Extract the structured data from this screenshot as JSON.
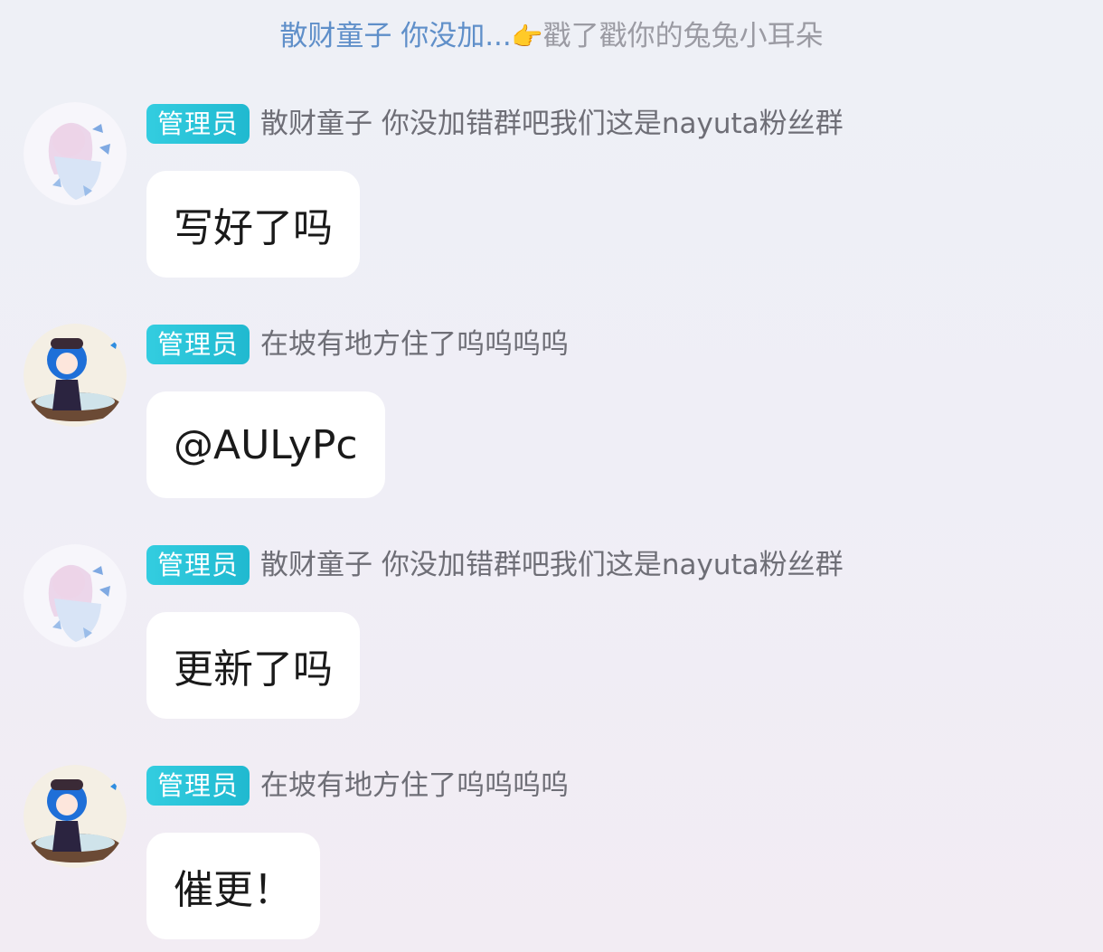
{
  "poke": {
    "user": "散财童子 你没加...",
    "emoji": "👉",
    "action": "戳了戳你的兔兔小耳朵"
  },
  "messages": [
    {
      "badge": "管理员",
      "sender": "散财童子 你没加错群吧我们这是nayuta粉丝群",
      "text": "写好了吗",
      "avatar": "pink-haired-anime-avatar"
    },
    {
      "badge": "管理员",
      "sender": "在坡有地方住了呜呜呜呜",
      "text": "@AULyPc",
      "avatar": "blue-haired-anime-avatar"
    },
    {
      "badge": "管理员",
      "sender": "散财童子 你没加错群吧我们这是nayuta粉丝群",
      "text": "更新了吗",
      "avatar": "pink-haired-anime-avatar"
    },
    {
      "badge": "管理员",
      "sender": "在坡有地方住了呜呜呜呜",
      "text": "催更！",
      "avatar": "blue-haired-anime-avatar"
    }
  ],
  "colors": {
    "badge": "#20b9d0",
    "poke_user": "#5f8fc9",
    "sender": "#6e6e76",
    "bubble": "#ffffff"
  }
}
